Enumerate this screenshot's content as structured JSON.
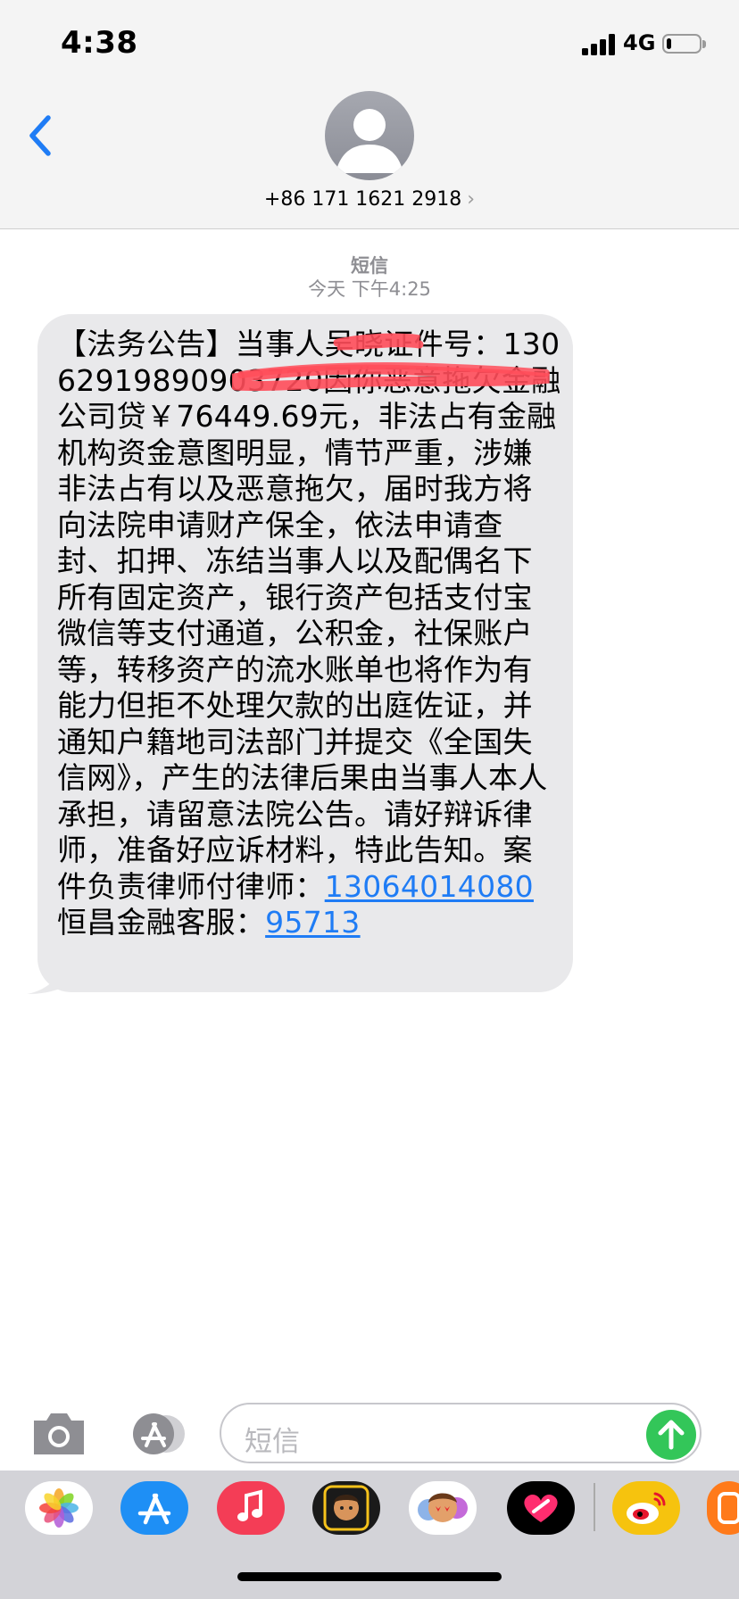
{
  "status_bar": {
    "time": "4:38",
    "network": "4G",
    "battery_level": 0.15
  },
  "header": {
    "back_icon": "chevron-left-icon",
    "avatar_icon": "person-silhouette-icon",
    "contact": "+86 171 1621 2918",
    "chevron": "›"
  },
  "thread": {
    "message_type": "短信",
    "timestamp": "今天 下午4:25",
    "message": {
      "body": "【法务公告】当事人吴晓证件号：13062919890903720因你恶意拖欠金融公司贷￥76449.69元，非法占有金融机构资金意图明显，情节严重，涉嫌非法占有以及恶意拖欠，届时我方将向法院申请财产保全，依法申请查封、扣押、冻结当事人以及配偶名下所有固定资产，银行资产包括支付宝微信等支付通道，公积金，社保账户等，转移资产的流水账单也将作为有能力但拒不处理欠款的出庭佐证，并通知户籍地司法部门并提交《全国失信网》，产生的法律后果由当事人本人承担，请留意法院公告。请好辩诉律师，准备好应诉材料，特此告知。案件负责律师付律师：",
      "lawyer_phone": "13064014080",
      "service_label": "恒昌金融客服：",
      "service_phone": "95713"
    }
  },
  "compose": {
    "placeholder": "短信",
    "camera_icon": "camera-icon",
    "apps_icon": "app-store-icon",
    "send_icon": "send-arrow-icon"
  },
  "app_drawer": {
    "apps": [
      "photos-icon",
      "app-store-icon",
      "music-icon",
      "memoji-camera-icon",
      "memoji-icon",
      "digital-touch-icon",
      "weibo-icon",
      "orange-app-icon"
    ]
  },
  "colors": {
    "accent_blue": "#1f7cf5",
    "bubble_gray": "#e9e9eb",
    "send_green": "#33c659",
    "redaction_red": "#ff4d5a"
  }
}
